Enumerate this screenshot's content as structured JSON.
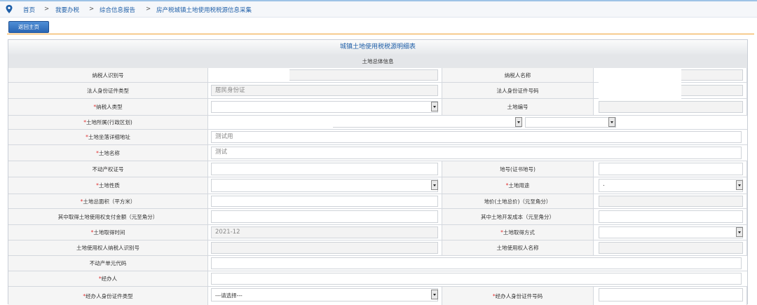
{
  "breadcrumb": {
    "items": [
      "首页",
      "我要办税",
      "综合信息报告",
      "房产税城镇土地使用税税源信息采集"
    ],
    "separator": ">"
  },
  "toolbar": {
    "home_button": "返回主页"
  },
  "form": {
    "title": "城镇土地使用税税源明细表",
    "section": "土地总体信息",
    "required_mark": "*",
    "labels": {
      "taxpayer_id": "纳税人识别号",
      "taxpayer_name": "纳税人名称",
      "legal_id_type": "法人身份证件类型",
      "legal_id_no": "法人身份证件号码",
      "taxpayer_type": "纳税人类型",
      "land_no": "土地编号",
      "land_region": "土地所属(行政区划)",
      "land_address": "土地坐落详细地址",
      "land_name": "土地名称",
      "property_cert": "不动产权证号",
      "lot_no": "地号(证书地号)",
      "land_nature": "土地性质",
      "land_use": "土地用途",
      "land_area": "土地总面积（平方米）",
      "land_price": "地价(土地总价)（元至角分）",
      "land_use_right_paid": "其中取得土地使用权支付金额（元至角分）",
      "land_dev_cost": "其中土地开发成本（元至角分）",
      "acquire_time": "土地取得时间",
      "acquire_method": "土地取得方式",
      "right_holder_id": "土地使用权人纳税人识别号",
      "right_holder_name": "土地使用权人名称",
      "unit_code": "不动产单元代码",
      "handler": "经办人",
      "handler_id_type": "经办人身份证件类型",
      "handler_id_no": "经办人身份证件号码"
    },
    "values": {
      "legal_id_type": "居民身份证",
      "land_address": "测试用",
      "land_name": "测试",
      "acquire_time": "2021-12",
      "land_use": ".",
      "handler_id_type": "---请选择---"
    }
  }
}
